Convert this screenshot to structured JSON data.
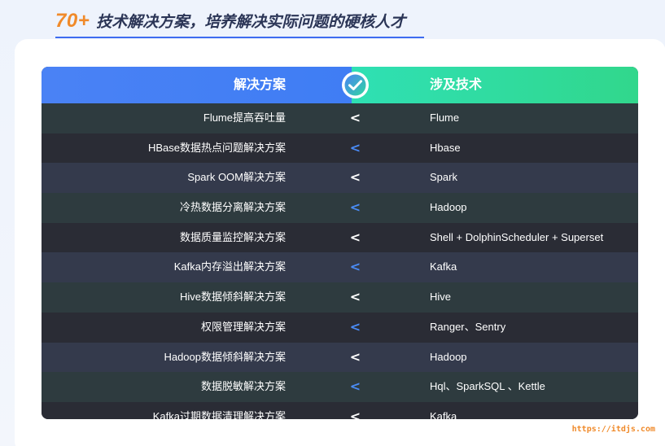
{
  "header": {
    "number": "70+",
    "title": "技术解决方案，培养解决实际问题的硬核人才"
  },
  "table": {
    "col_solution": "解决方案",
    "col_tech": "涉及技术",
    "badge_icon": "check-circle-icon",
    "arrow_glyph": "< >",
    "rows": [
      {
        "solution": "Flume提高吞吐量",
        "tech": "Flume"
      },
      {
        "solution": "HBase数据热点问题解决方案",
        "tech": "Hbase"
      },
      {
        "solution": "Spark OOM解决方案",
        "tech": "Spark"
      },
      {
        "solution": "冷热数据分离解决方案",
        "tech": "Hadoop"
      },
      {
        "solution": "数据质量监控解决方案",
        "tech": "Shell + DolphinScheduler + Superset"
      },
      {
        "solution": "Kafka内存溢出解决方案",
        "tech": "Kafka"
      },
      {
        "solution": "Hive数据倾斜解决方案",
        "tech": "Hive"
      },
      {
        "solution": "权限管理解决方案",
        "tech": "Ranger、Sentry"
      },
      {
        "solution": "Hadoop数据倾斜解决方案",
        "tech": "Hadoop"
      },
      {
        "solution": "数据脱敏解决方案",
        "tech": "Hql、SparkSQL 、Kettle"
      },
      {
        "solution": "Kafka过期数据清理解决方案",
        "tech": "Kafka"
      }
    ]
  },
  "colors": {
    "accent_orange": "#f08a2a",
    "header_blue": "#4a82f5",
    "header_green": "#31d78c",
    "arrow_blue": "#4a8cf7"
  },
  "watermark": "https://itdjs.com"
}
